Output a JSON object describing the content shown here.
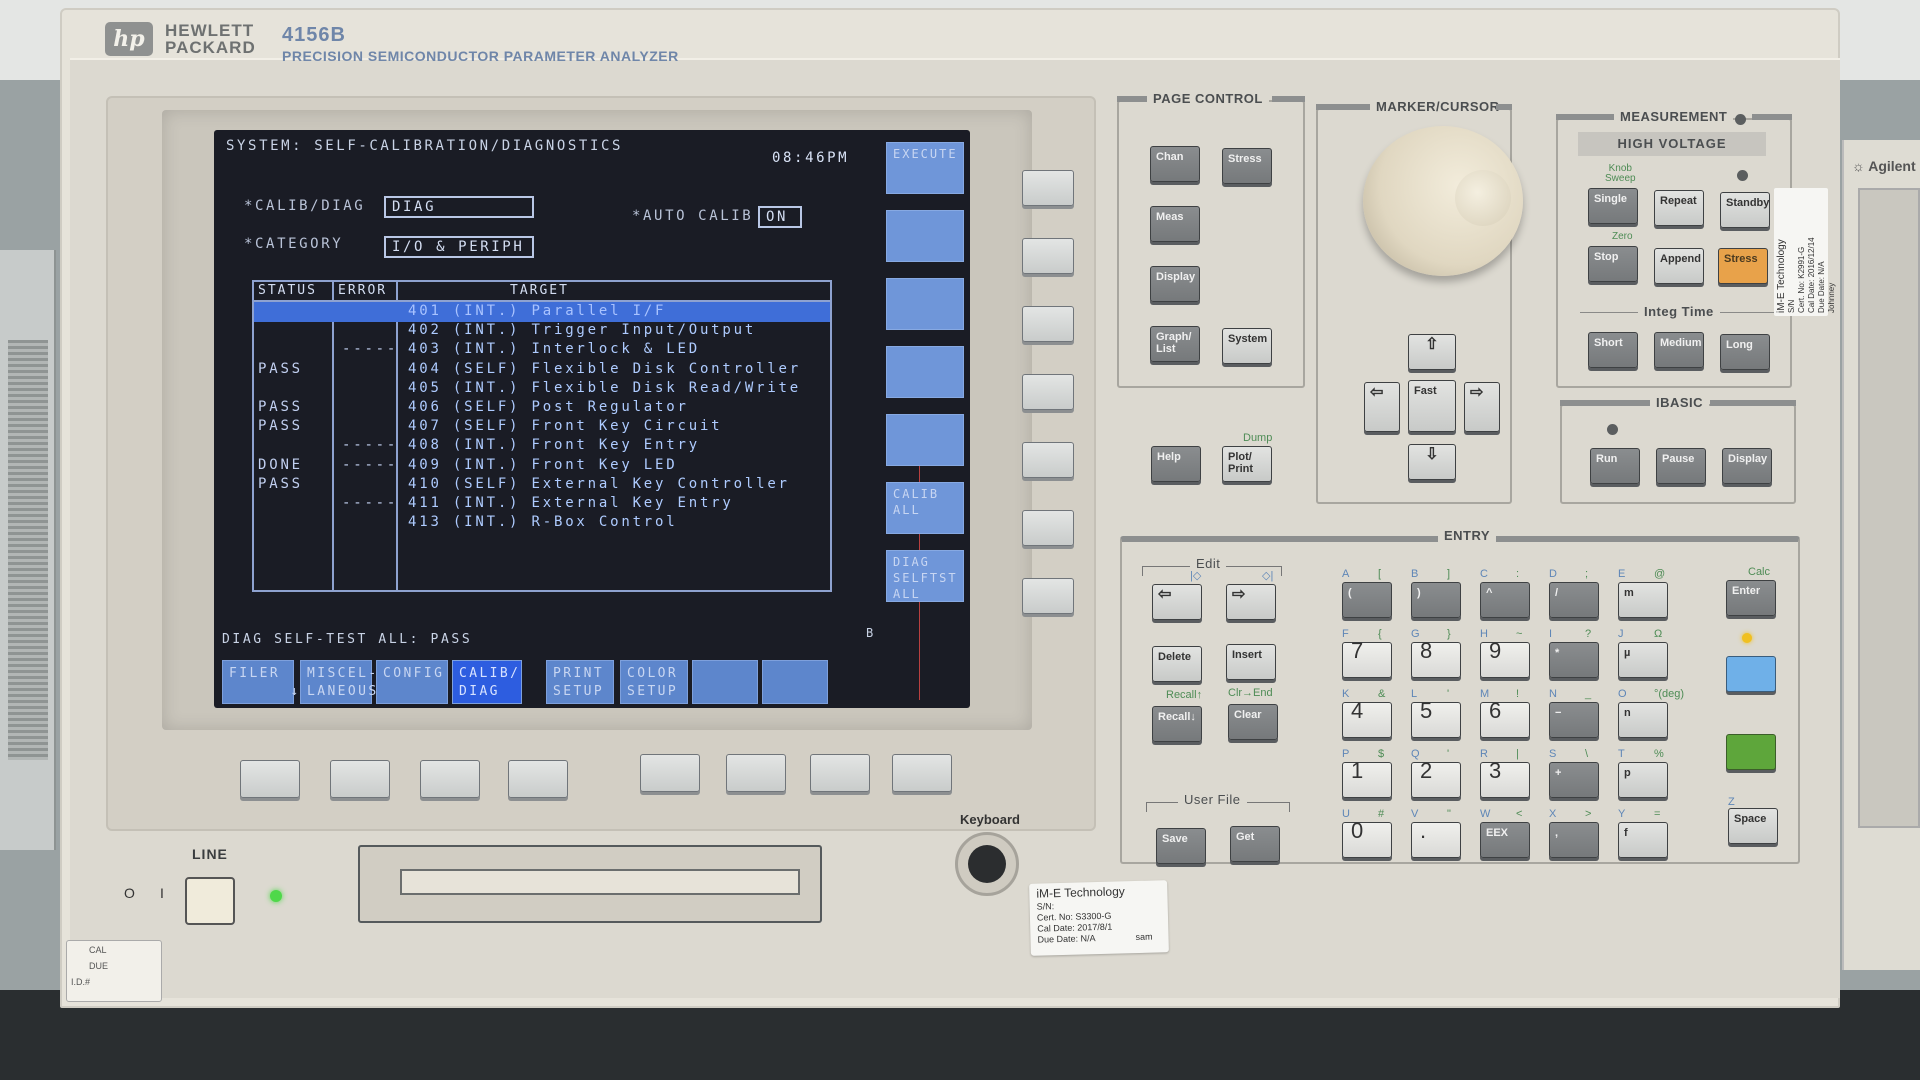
{
  "instrument": {
    "brand_line1": "HEWLETT",
    "brand_line2": "PACKARD",
    "brand_logo": "hp",
    "model": "4156B",
    "description": "PRECISION SEMICONDUCTOR PARAMETER ANALYZER"
  },
  "screen": {
    "title": "SYSTEM: SELF-CALIBRATION/DIAGNOSTICS",
    "clock": "08:46PM",
    "calib_diag_label": "*CALIB/DIAG",
    "calib_diag_value": "DIAG",
    "auto_calib_label": "*AUTO CALIB",
    "auto_calib_value": "ON",
    "category_label": "*CATEGORY",
    "category_value": "I/O & PERIPH",
    "table": {
      "headers": [
        "STATUS",
        "ERROR",
        "TARGET"
      ],
      "rows": [
        {
          "status": "",
          "error": "",
          "target": "401 (INT.) Parallel I/F",
          "selected": true
        },
        {
          "status": "",
          "error": "",
          "target": "402 (INT.) Trigger Input/Output"
        },
        {
          "status": "",
          "error": "-----",
          "target": "403 (INT.) Interlock & LED"
        },
        {
          "status": "PASS",
          "error": "",
          "target": "404 (SELF) Flexible Disk Controller"
        },
        {
          "status": "",
          "error": "",
          "target": "405 (INT.) Flexible Disk Read/Write"
        },
        {
          "status": "PASS",
          "error": "",
          "target": "406 (SELF) Post Regulator"
        },
        {
          "status": "PASS",
          "error": "",
          "target": "407 (SELF) Front Key Circuit"
        },
        {
          "status": "",
          "error": "-----",
          "target": "408 (INT.) Front Key Entry"
        },
        {
          "status": "DONE",
          "error": "-----",
          "target": "409 (INT.) Front Key LED"
        },
        {
          "status": "PASS",
          "error": "",
          "target": "410 (SELF) External Key Controller"
        },
        {
          "status": "",
          "error": "-----",
          "target": "411 (INT.) External Key Entry"
        },
        {
          "status": "",
          "error": "",
          "target": "413 (INT.) R-Box Control"
        }
      ]
    },
    "status_message": "DIAG SELF-TEST ALL: PASS",
    "indicator": "B",
    "side_softkeys": [
      "EXECUTE",
      "",
      "",
      "",
      "",
      "CALIB\nALL",
      "DIAG\nSELFTST\nALL"
    ],
    "bottom_softkeys": [
      {
        "label": "FILER\n      ↓",
        "active": false
      },
      {
        "label": "MISCEL-\nLANEOUS",
        "active": false
      },
      {
        "label": "CONFIG",
        "active": false
      },
      {
        "label": "CALIB/\nDIAG",
        "active": true
      },
      {
        "label": "PRINT\nSETUP",
        "active": false
      },
      {
        "label": "COLOR\nSETUP",
        "active": false
      },
      {
        "label": "",
        "active": false
      },
      {
        "label": "",
        "active": false
      }
    ]
  },
  "front": {
    "line_label": "LINE",
    "power_off_symbol": "O",
    "power_on_symbol": "I",
    "keyboard_label": "Keyboard",
    "cal_sticker": {
      "cal": "CAL",
      "due": "DUE",
      "id": "I.D.#"
    },
    "ime_sticker": {
      "company": "iM-E Technology",
      "sn": "S/N:",
      "cert": "Cert. No:  S3300-G",
      "cal_date": "Cal Date:  2017/8/1",
      "due_date": "Due Date: N/A",
      "tech": "sam"
    }
  },
  "page_control": {
    "title": "PAGE CONTROL",
    "keys": {
      "chan": "Chan",
      "stress": "Stress",
      "meas": "Meas",
      "display": "Display",
      "graph_list": "Graph/\nList",
      "system": "System"
    },
    "help": "Help",
    "plot_print": "Plot/\nPrint",
    "dump_shift": "Dump"
  },
  "marker_cursor": {
    "title": "MARKER/CURSOR",
    "fast": "Fast"
  },
  "measurement": {
    "title": "MEASUREMENT",
    "high_voltage": "HIGH VOLTAGE",
    "knob_sweep_shift": "Knob\nSweep",
    "zero_shift": "Zero",
    "keys": {
      "single": "Single",
      "repeat": "Repeat",
      "standby": "Standby",
      "stop": "Stop",
      "append": "Append",
      "stress": "Stress"
    },
    "integ_time_title": "Integ Time",
    "integ": {
      "short": "Short",
      "medium": "Medium",
      "long": "Long"
    },
    "side_sticker": {
      "company": "iM-E Technology",
      "lines": [
        "S/N",
        "Cert. No: K2991-G",
        "Cal Date: 2016/12/14",
        "Due Date: N/A",
        "Johnney"
      ]
    }
  },
  "ibasic": {
    "title": "IBASIC",
    "keys": {
      "run": "Run",
      "pause": "Pause",
      "display": "Display"
    }
  },
  "entry": {
    "title": "ENTRY",
    "edit_title": "Edit",
    "edit_home": "|◇",
    "edit_end": "◇|",
    "delete": "Delete",
    "insert": "Insert",
    "recall_shift": "Recall↑",
    "clr_end_shift": "Clr→End",
    "recall": "Recall↓",
    "clear": "Clear",
    "user_file_title": "User File",
    "save": "Save",
    "get": "Get",
    "calc_shift": "Calc",
    "enter": "Enter",
    "space": "Space",
    "space_shift": "Z",
    "keypad": [
      [
        {
          "key": "(",
          "a": "A",
          "s": "[",
          "t": "dark"
        },
        {
          "key": ")",
          "a": "B",
          "s": "]",
          "t": "dark"
        },
        {
          "key": "^",
          "a": "C",
          "s": ":",
          "t": "dark"
        },
        {
          "key": "/",
          "a": "D",
          "s": ";",
          "t": "dark"
        },
        {
          "key": "m",
          "a": "E",
          "s": "@",
          "t": "light"
        }
      ],
      [
        {
          "key": "7",
          "a": "F",
          "s": "{",
          "t": "num"
        },
        {
          "key": "8",
          "a": "G",
          "s": "}",
          "t": "num"
        },
        {
          "key": "9",
          "a": "H",
          "s": "~",
          "t": "num"
        },
        {
          "key": "*",
          "a": "I",
          "s": "?",
          "t": "dark"
        },
        {
          "key": "µ",
          "a": "J",
          "s": "Ω",
          "t": "light"
        }
      ],
      [
        {
          "key": "4",
          "a": "K",
          "s": "&",
          "t": "num"
        },
        {
          "key": "5",
          "a": "L",
          "s": "'",
          "t": "num"
        },
        {
          "key": "6",
          "a": "M",
          "s": "!",
          "t": "num"
        },
        {
          "key": "−",
          "a": "N",
          "s": "_",
          "t": "dark"
        },
        {
          "key": "n",
          "a": "O",
          "s": "°(deg)",
          "t": "light"
        }
      ],
      [
        {
          "key": "1",
          "a": "P",
          "s": "$",
          "t": "num"
        },
        {
          "key": "2",
          "a": "Q",
          "s": "'",
          "t": "num"
        },
        {
          "key": "3",
          "a": "R",
          "s": "|",
          "t": "num"
        },
        {
          "key": "+",
          "a": "S",
          "s": "\\",
          "t": "dark"
        },
        {
          "key": "p",
          "a": "T",
          "s": "%",
          "t": "light"
        }
      ],
      [
        {
          "key": "0",
          "a": "U",
          "s": "#",
          "t": "num"
        },
        {
          "key": ".",
          "a": "V",
          "s": "\"",
          "t": "num"
        },
        {
          "key": "EEX",
          "a": "W",
          "s": "<",
          "t": "dark"
        },
        {
          "key": ",",
          "a": "X",
          "s": ">",
          "t": "dark"
        },
        {
          "key": "f",
          "a": "Y",
          "s": "=",
          "t": "light"
        }
      ]
    ]
  },
  "next_unit": {
    "brand": "Agilent"
  }
}
